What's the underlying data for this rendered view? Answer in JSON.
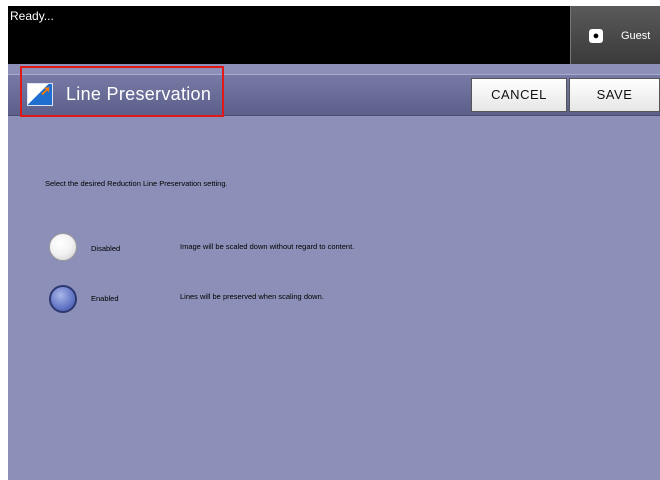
{
  "status": {
    "text": "Ready..."
  },
  "user": {
    "icon": "user-key-icon",
    "name": "Guest"
  },
  "header": {
    "title": "Line Preservation",
    "icon": "line-preservation-icon",
    "cancel_label": "CANCEL",
    "save_label": "SAVE"
  },
  "content": {
    "instruction": "Select the desired Reduction Line Preservation setting.",
    "options": [
      {
        "label": "Disabled",
        "description": "Image will be scaled down without regard to content.",
        "selected": false
      },
      {
        "label": "Enabled",
        "description": "Lines will be preserved when scaling down.",
        "selected": true
      }
    ]
  },
  "colors": {
    "background": "#8c90b8",
    "header": "#5b5f8a",
    "highlight": "#e01818"
  }
}
